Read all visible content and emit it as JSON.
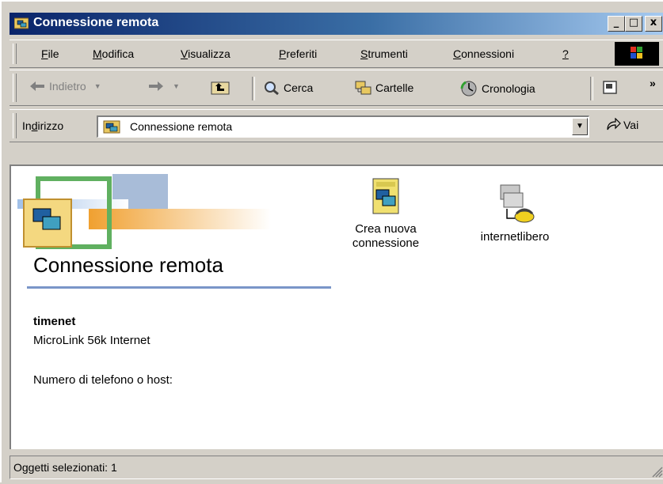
{
  "window": {
    "title": "Connessione remota"
  },
  "title_buttons": {
    "minimize": "_",
    "maximize": "□",
    "close": "x"
  },
  "menu": {
    "items": [
      {
        "label": "File",
        "accel": "F",
        "rest": "ile"
      },
      {
        "label": "Modifica",
        "accel": "M",
        "rest": "odifica"
      },
      {
        "label": "Visualizza",
        "accel": "V",
        "rest": "isualizza"
      },
      {
        "label": "Preferiti",
        "accel": "P",
        "rest": "referiti"
      },
      {
        "label": "Strumenti",
        "accel": "S",
        "rest": "trumenti"
      },
      {
        "label": "Connessioni",
        "accel": "C",
        "rest": "onnessioni"
      },
      {
        "label": "?",
        "accel": "?",
        "rest": ""
      }
    ]
  },
  "toolbar": {
    "back": "Indietro",
    "search": "Cerca",
    "folders": "Cartelle",
    "history": "Cronologia",
    "more": "»"
  },
  "address": {
    "label_pre": "In",
    "label_accel": "d",
    "label_post": "irizzo",
    "value": "Connessione remota",
    "go": "Vai"
  },
  "content": {
    "banner_title": "Connessione remota",
    "icons": [
      {
        "line1": "Crea nuova",
        "line2": "connessione"
      },
      {
        "line1": "internetlibero",
        "line2": ""
      }
    ],
    "details": {
      "name": "timenet",
      "device": "MicroLink 56k Internet",
      "phone_label": "Numero di telefono o host:"
    }
  },
  "status": {
    "text": "Oggetti selezionati: 1"
  },
  "colors": {
    "title_start": "#0a246a",
    "title_end": "#a6caf0",
    "face": "#d4d0c8",
    "accent_line": "#7a96c8"
  }
}
